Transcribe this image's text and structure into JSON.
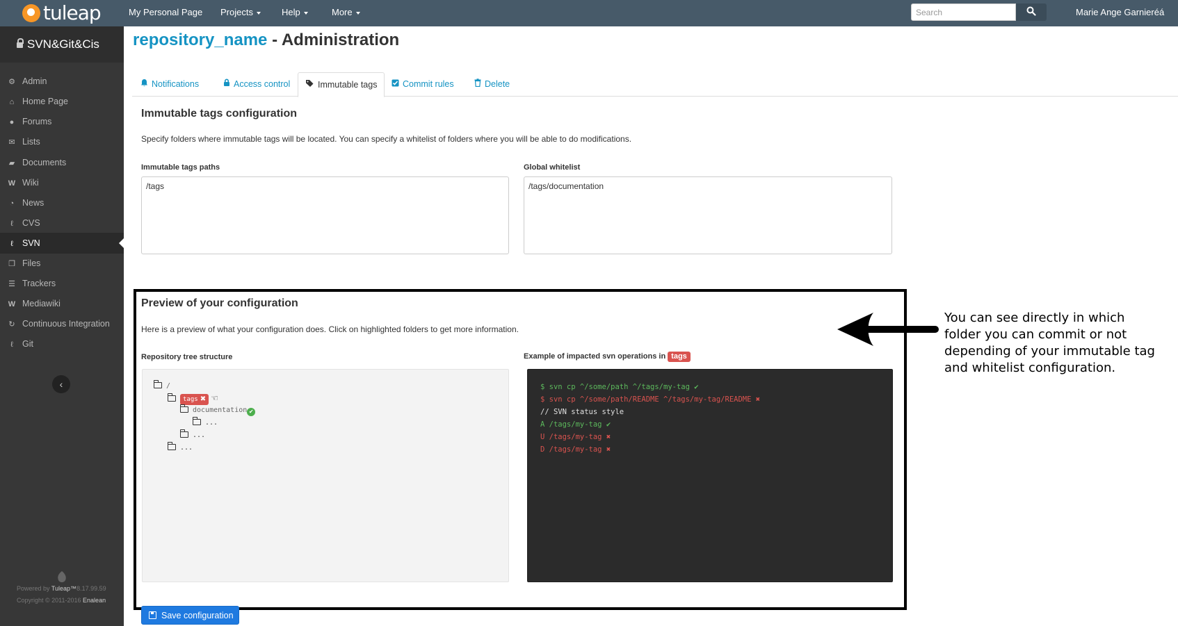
{
  "navbar": {
    "logo_text": "tuleap",
    "items": [
      {
        "label": "My Personal Page"
      },
      {
        "label": "Projects"
      },
      {
        "label": "Help"
      },
      {
        "label": "More"
      }
    ],
    "search_placeholder": "Search",
    "user_name": "Marie Ange Garnieréá"
  },
  "sidebar": {
    "project_name": "SVN&Git&Cis",
    "items": [
      {
        "label": "Admin",
        "icon": "gears-icon"
      },
      {
        "label": "Home Page",
        "icon": "home-icon"
      },
      {
        "label": "Forums",
        "icon": "users-icon"
      },
      {
        "label": "Lists",
        "icon": "envelope-icon"
      },
      {
        "label": "Documents",
        "icon": "folder-open-icon"
      },
      {
        "label": "Wiki",
        "icon": "wiki-icon"
      },
      {
        "label": "News",
        "icon": "rss-icon"
      },
      {
        "label": "CVS",
        "icon": "cvs-icon"
      },
      {
        "label": "SVN",
        "icon": "svn-icon",
        "active": true
      },
      {
        "label": "Files",
        "icon": "files-icon"
      },
      {
        "label": "Trackers",
        "icon": "list-icon"
      },
      {
        "label": "Mediawiki",
        "icon": "mediawiki-icon"
      },
      {
        "label": "Continuous Integration",
        "icon": "refresh-icon"
      },
      {
        "label": "Git",
        "icon": "git-icon"
      }
    ],
    "powered_prefix": "Powered by",
    "powered_brand": "Tuleap™",
    "powered_version": "8.17.99.59",
    "copyright_prefix": "Copyright © 2011-2016",
    "copyright_brand": "Enalean"
  },
  "page": {
    "repo_name": "repository_name",
    "title_suffix": " - Administration"
  },
  "tabs": [
    {
      "label": "Notifications",
      "icon": "bell-icon"
    },
    {
      "label": "Access control",
      "icon": "lock-icon"
    },
    {
      "label": "Immutable tags",
      "icon": "tags-icon",
      "active": true
    },
    {
      "label": "Commit rules",
      "icon": "checkbox-icon"
    },
    {
      "label": "Delete",
      "icon": "trash-icon"
    }
  ],
  "config": {
    "heading": "Immutable tags configuration",
    "description": "Specify folders where immutable tags will be located. You can specify a whitelist of folders where you will be able to do modifications.",
    "paths_label": "Immutable tags paths",
    "paths_value": "/tags",
    "whitelist_label": "Global whitelist",
    "whitelist_value": "/tags/documentation"
  },
  "preview": {
    "heading": "Preview of your configuration",
    "description": "Here is a preview of what your configuration does. Click on highlighted folders to get more information.",
    "tree_label": "Repository tree structure",
    "ops_label": "Example of impacted svn operations in",
    "ops_tag": "tags",
    "tree": {
      "root": "/",
      "tags": "tags",
      "documentation": "documentation",
      "doc_children": "...",
      "tags_children": "...",
      "root_children": "..."
    },
    "console": [
      {
        "text": "$ svn cp ^/some/path ^/tags/my-tag",
        "status": "ok"
      },
      {
        "text": "$ svn cp ^/some/path/README ^/tags/my-tag/README",
        "status": "error"
      },
      {
        "text": "// SVN status style",
        "status": "comment"
      },
      {
        "text": "A /tags/my-tag",
        "status": "ok"
      },
      {
        "text": "U /tags/my-tag",
        "status": "error"
      },
      {
        "text": "D /tags/my-tag",
        "status": "error"
      }
    ]
  },
  "callout": {
    "lines": [
      "You can see directly in which",
      "folder you can commit or not",
      "depending of your immutable tag",
      "and whitelist configuration."
    ]
  },
  "actions": {
    "save_label": "Save configuration"
  },
  "colors": {
    "navbar": "#475a69",
    "sidebar": "#373737",
    "link": "#1593c3",
    "success": "#5cb85c",
    "danger": "#d9534f",
    "primary": "#1f7ae0"
  }
}
